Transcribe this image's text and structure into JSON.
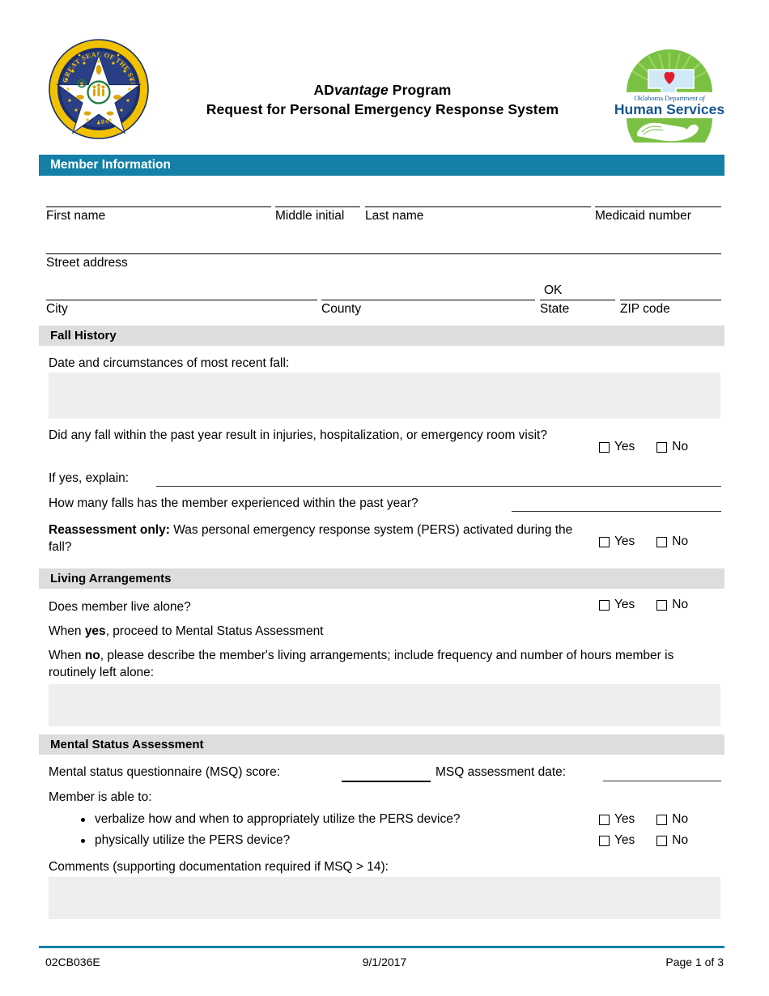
{
  "document": {
    "title_line1_prefix": "AD",
    "title_line1_italic": "vantage",
    "title_line1_suffix": " Program",
    "title_line2": "Request for Personal Emergency Response System",
    "seal_alt": "Great Seal of the State of Oklahoma 1907",
    "dhs_logo_line1": "Oklahoma Department of",
    "dhs_logo_line2": "Human Services"
  },
  "colors": {
    "accent_teal": "#1480a8",
    "section_gray": "#dddddd",
    "textbox_gray": "#eeeeee"
  },
  "sections": {
    "member_information": {
      "heading": "Member Information",
      "fields": [
        {
          "label": "First name",
          "value": ""
        },
        {
          "label": "Middle initial",
          "value": ""
        },
        {
          "label": "Last name",
          "value": ""
        },
        {
          "label": "Medicaid number",
          "value": ""
        },
        {
          "label": "Street address",
          "value": ""
        },
        {
          "label": "City",
          "value": ""
        },
        {
          "label": "County",
          "value": ""
        },
        {
          "label": "State",
          "value": "OK"
        },
        {
          "label": "ZIP code",
          "value": ""
        }
      ]
    },
    "fall_history": {
      "heading": "Fall History",
      "prompt_recent_fall": "Date and circumstances of most recent fall:",
      "recent_fall_value": "",
      "q_injury": "Did any fall within the past year result in injuries, hospitalization, or emergency room visit?",
      "q_injury_yes": "Yes",
      "q_injury_no": "No",
      "if_yes_explain_label": "If yes, explain:",
      "if_yes_explain_value": "",
      "q_how_many": "How many falls has the member experienced within the past year?",
      "how_many_value": "",
      "reassessment_bold": "Reassessment only:",
      "reassessment_rest": "  Was personal emergency response system (PERS) activated during the fall?",
      "q_reassessment_yes": "Yes",
      "q_reassessment_no": "No"
    },
    "living_arrangements": {
      "heading": "Living Arrangements",
      "q_live_alone": "Does member live alone?",
      "q_live_alone_yes": "Yes",
      "q_live_alone_no": "No",
      "when_yes_prefix": "When ",
      "when_yes_bold": "yes",
      "when_yes_suffix": ", proceed to Mental Status Assessment",
      "when_no_prefix": "When ",
      "when_no_bold": "no",
      "when_no_suffix": ", please describe the member's living arrangements; include frequency and number of hours member is routinely left alone:",
      "living_value": ""
    },
    "mental_status": {
      "heading": "Mental Status Assessment",
      "msq_score_label": "Mental status questionnaire (MSQ) score:",
      "msq_score_value": "",
      "msq_date_label": "MSQ assessment date:",
      "msq_date_value": "",
      "member_able_label": "Member is able to:",
      "bullets": [
        {
          "text": "verbalize how and when to appropriately utilize the PERS device?",
          "yes": "Yes",
          "no": "No"
        },
        {
          "text": "physically utilize the PERS device?",
          "yes": "Yes",
          "no": "No"
        }
      ],
      "comments_label": "Comments (supporting documentation required if MSQ > 14):",
      "comments_value": ""
    }
  },
  "footer": {
    "form_number": "02CB036E",
    "revision_date": "9/1/2017",
    "page_number": "Page 1 of 3"
  }
}
